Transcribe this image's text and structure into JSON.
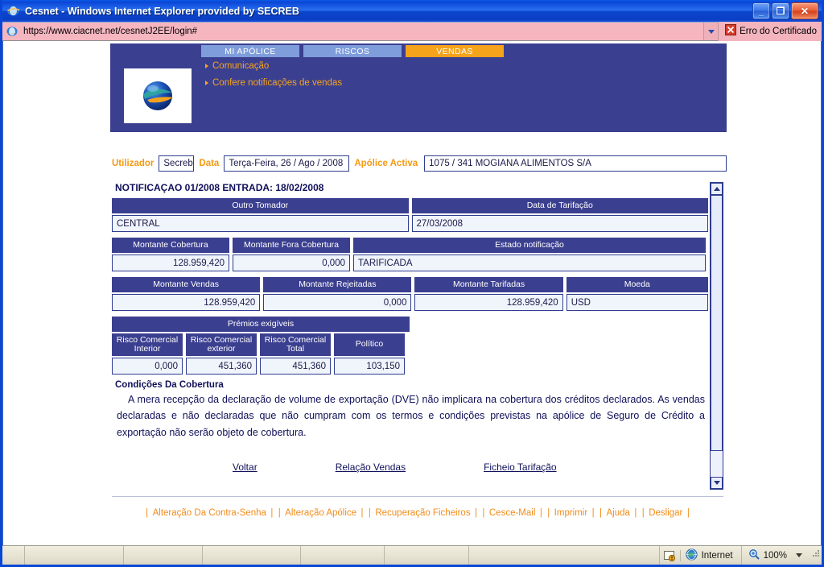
{
  "window": {
    "title": "Cesnet - Windows Internet Explorer provided by SECREB",
    "icon": "ie-logo-icon",
    "minimize_label": "_",
    "maximize_label": "❐",
    "close_label": "✕"
  },
  "address_bar": {
    "url": "https://www.ciacnet.net/cesnetJ2EE/login#",
    "favicon": "ie-page-icon",
    "dropdown_icon": "chevron-down-icon",
    "certificate_error": {
      "label": "Erro do Certificado",
      "icon": "certificate-error-icon"
    }
  },
  "site_header": {
    "logo": "company-globe-logo",
    "tabs": [
      {
        "label": "MI APÓLICE",
        "active": false
      },
      {
        "label": "RISCOS",
        "active": false
      },
      {
        "label": "VENDAS",
        "active": true
      }
    ],
    "nav_links": [
      "Comunicação",
      "Confere notificações de vendas"
    ]
  },
  "user_bar": {
    "user_label": "Utilizador",
    "user_value": "Secreb",
    "date_label": "Data",
    "date_value": "Terça-Feira, 26 / Ago / 2008",
    "policy_label": "Apólice Activa",
    "policy_value": "1075 / 341 MOGIANA ALIMENTOS S/A"
  },
  "document": {
    "title": "NOTIFICAÇAO 01/2008 ENTRADA: 18/02/2008",
    "row1": {
      "headers": [
        "Outro Tomador",
        "Data de Tarifação"
      ],
      "values": [
        "CENTRAL",
        "27/03/2008"
      ]
    },
    "row2": {
      "headers": [
        "Montante Cobertura",
        "Montante Fora Cobertura",
        "Estado notificação"
      ],
      "values": [
        "128.959,420",
        "0,000",
        "TARIFICADA"
      ]
    },
    "row3": {
      "headers": [
        "Montante Vendas",
        "Montante Rejeitadas",
        "Montante Tarifadas",
        "Moeda"
      ],
      "values": [
        "128.959,420",
        "0,000",
        "128.959,420",
        "USD"
      ]
    },
    "premios": {
      "group_header": "Prémios exigíveis",
      "headers": [
        [
          "Risco Comercial",
          "Interior"
        ],
        [
          "Risco Comercial",
          "exterior"
        ],
        [
          "Risco Comercial",
          "Total"
        ],
        [
          "Político",
          ""
        ]
      ],
      "values": [
        "0,000",
        "451,360",
        "451,360",
        "103,150"
      ]
    },
    "conditions_title": "Condições Da Cobertura",
    "conditions_text": "A mera recepção da declaração de volume de exportação (DVE) não implicara na cobertura dos créditos declarados. As vendas declaradas e não declaradas que não cumpram com os termos e condições previstas na apólice de Seguro de Crédito a exportação não serão objeto de cobertura.",
    "action_links": [
      "Voltar",
      "Relação Vendas",
      "Ficheio Tarifação"
    ]
  },
  "scrollbar": {
    "up_icon": "scroll-up-arrow-icon",
    "down_icon": "scroll-down-arrow-icon"
  },
  "footer_links": [
    "Alteração Da Contra-Senha",
    "Alteração Apólice",
    "Recuperação Ficheiros",
    "Cesce-Mail",
    "Imprimir",
    "Ajuda",
    "Desligar"
  ],
  "status_bar": {
    "security_icon": "security-warning-icon",
    "zone_icon": "internet-zone-icon",
    "zone_label": "Internet",
    "zoom_icon": "zoom-magnifier-icon",
    "zoom_label": "100%",
    "zoom_dropdown_icon": "chevron-down-icon",
    "resize_grip": "resize-grip-icon"
  },
  "colors": {
    "header_navy": "#3b3f8f",
    "tab_blue": "#7f9ddb",
    "tab_active_orange": "#f5a31b",
    "link_orange": "#f28c1a",
    "text_navy": "#10105a",
    "address_pink": "#f3b4bd"
  }
}
